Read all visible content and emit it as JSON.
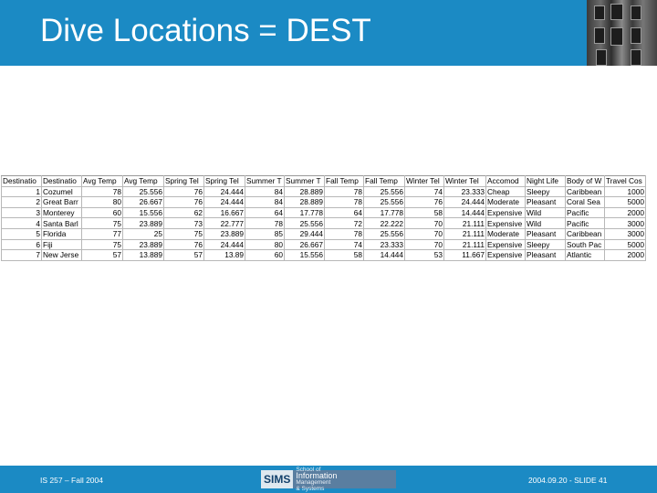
{
  "slide": {
    "title": "Dive Locations = DEST",
    "footer_left": "IS 257 – Fall 2004",
    "footer_right": "2004.09.20 - SLIDE 41",
    "logo": {
      "main": "SIMS",
      "line1": "School of",
      "line2": "Information",
      "line3": "Management",
      "line4": "& Systems"
    }
  },
  "colors": {
    "header": "#1b8ac4",
    "footer": "#1b8ac4",
    "title_text": "#ffffff"
  },
  "table": {
    "headers": [
      "Destinatio",
      "Destinatio",
      "Avg Temp",
      "Avg Temp",
      "Spring Tel",
      "Spring Tel",
      "Summer T",
      "Summer T",
      "Fall Temp",
      "Fall Temp",
      "Winter Tel",
      "Winter Tel",
      "Accomod",
      "Night Life",
      "Body of W",
      "Travel Cos"
    ],
    "rows": [
      [
        "1",
        "Cozumel",
        "78",
        "25.556",
        "76",
        "24.444",
        "84",
        "28.889",
        "78",
        "25.556",
        "74",
        "23.333",
        "Cheap",
        "Sleepy",
        "Caribbean",
        "1000"
      ],
      [
        "2",
        "Great Barr",
        "80",
        "26.667",
        "76",
        "24.444",
        "84",
        "28.889",
        "78",
        "25.556",
        "76",
        "24.444",
        "Moderate",
        "Pleasant",
        "Coral Sea",
        "5000"
      ],
      [
        "3",
        "Monterey",
        "60",
        "15.556",
        "62",
        "16.667",
        "64",
        "17.778",
        "64",
        "17.778",
        "58",
        "14.444",
        "Expensive",
        "Wild",
        "Pacific",
        "2000"
      ],
      [
        "4",
        "Santa Barl",
        "75",
        "23.889",
        "73",
        "22.777",
        "78",
        "25.556",
        "72",
        "22.222",
        "70",
        "21.111",
        "Expensive",
        "Wild",
        "Pacific",
        "3000"
      ],
      [
        "5",
        "Florida",
        "77",
        "25",
        "75",
        "23.889",
        "85",
        "29.444",
        "78",
        "25.556",
        "70",
        "21.111",
        "Moderate",
        "Pleasant",
        "Caribbean",
        "3000"
      ],
      [
        "6",
        "Fiji",
        "75",
        "23.889",
        "76",
        "24.444",
        "80",
        "26.667",
        "74",
        "23.333",
        "70",
        "21.111",
        "Expensive",
        "Sleepy",
        "South Pac",
        "5000"
      ],
      [
        "7",
        "New Jerse",
        "57",
        "13.889",
        "57",
        "13.89",
        "60",
        "15.556",
        "58",
        "14.444",
        "53",
        "11.667",
        "Expensive",
        "Pleasant",
        "Atlantic",
        "2000"
      ]
    ]
  }
}
